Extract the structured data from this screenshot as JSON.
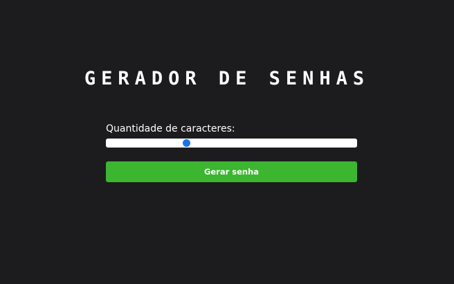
{
  "app": {
    "title": "GERADOR DE SENHAS"
  },
  "form": {
    "length_label": "Quantidade de caracteres:",
    "length_slider": {
      "fraction": 0.32
    },
    "generate_button_label": "Gerar senha"
  },
  "colors": {
    "background": "#1c1c1e",
    "slider_track": "#ffffff",
    "slider_thumb": "#1a73e8",
    "button": "#3cb531",
    "text": "#ffffff"
  }
}
